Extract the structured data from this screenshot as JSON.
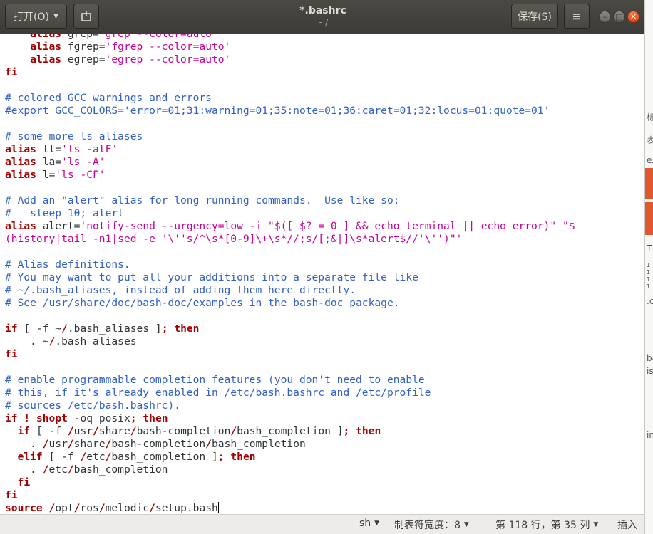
{
  "header": {
    "open_label": "打开(O)",
    "save_label": "保存(S)",
    "title": "*.bashrc",
    "subtitle": "~/"
  },
  "icons": {
    "open_dropdown": "chevron-down-icon",
    "new_document": "new-document-icon",
    "menu": "hamburger-menu-icon",
    "minimize": "window-minimize-icon",
    "maximize": "window-maximize-icon",
    "close": "window-close-icon"
  },
  "editor": {
    "lines": [
      [
        {
          "t": "    "
        },
        {
          "t": "alias",
          "c": "kw"
        },
        {
          "t": " grep="
        },
        {
          "t": "'grep --color=auto'",
          "c": "str"
        }
      ],
      [
        {
          "t": "    "
        },
        {
          "t": "alias",
          "c": "kw"
        },
        {
          "t": " fgrep="
        },
        {
          "t": "'fgrep --color=auto'",
          "c": "str"
        }
      ],
      [
        {
          "t": "    "
        },
        {
          "t": "alias",
          "c": "kw"
        },
        {
          "t": " egrep="
        },
        {
          "t": "'egrep --color=auto'",
          "c": "str"
        }
      ],
      [
        {
          "t": "fi",
          "c": "kw"
        }
      ],
      [],
      [
        {
          "t": "# colored GCC warnings and errors",
          "c": "cm"
        }
      ],
      [
        {
          "t": "#export GCC_COLORS='error=01;31:warning=01;35:note=01;36:caret=01;32:locus=01:quote=01'",
          "c": "cm"
        }
      ],
      [],
      [
        {
          "t": "# some more ls aliases",
          "c": "cm"
        }
      ],
      [
        {
          "t": "alias",
          "c": "kw"
        },
        {
          "t": " ll="
        },
        {
          "t": "'ls -alF'",
          "c": "str"
        }
      ],
      [
        {
          "t": "alias",
          "c": "kw"
        },
        {
          "t": " la="
        },
        {
          "t": "'ls -A'",
          "c": "str"
        }
      ],
      [
        {
          "t": "alias",
          "c": "kw"
        },
        {
          "t": " l="
        },
        {
          "t": "'ls -CF'",
          "c": "str"
        }
      ],
      [],
      [
        {
          "t": "# Add an \"alert\" alias for long running commands.  Use like so:",
          "c": "cm"
        }
      ],
      [
        {
          "t": "#   sleep 10; alert",
          "c": "cm"
        }
      ],
      [
        {
          "t": "alias",
          "c": "kw"
        },
        {
          "t": " alert="
        },
        {
          "t": "'notify-send --urgency=low -i \"$([ $? = 0 ] && echo terminal || echo error)\" \"$",
          "c": "str"
        }
      ],
      [
        {
          "t": "(history|tail -n1|sed -e '\\''s/^\\s*[0-9]\\+\\s*//;s/[;&|]\\s*alert$//'\\'')\"'",
          "c": "str"
        }
      ],
      [],
      [
        {
          "t": "# Alias definitions.",
          "c": "cm"
        }
      ],
      [
        {
          "t": "# You may want to put all your additions into a separate file like",
          "c": "cm"
        }
      ],
      [
        {
          "t": "# ~/.bash_aliases, instead of adding them here directly.",
          "c": "cm"
        }
      ],
      [
        {
          "t": "# See /usr/share/doc/bash-doc/examples in the bash-doc package.",
          "c": "cm"
        }
      ],
      [],
      [
        {
          "t": "if",
          "c": "kw"
        },
        {
          "t": " [ -f ~"
        },
        {
          "t": "/",
          "c": "kw"
        },
        {
          "t": ".bash_aliases ]"
        },
        {
          "t": ";",
          "c": "kw"
        },
        {
          "t": " "
        },
        {
          "t": "then",
          "c": "kw"
        }
      ],
      [
        {
          "t": "    . ~"
        },
        {
          "t": "/",
          "c": "kw"
        },
        {
          "t": ".bash_aliases"
        }
      ],
      [
        {
          "t": "fi",
          "c": "kw"
        }
      ],
      [],
      [
        {
          "t": "# enable programmable completion features (you don't need to enable",
          "c": "cm"
        }
      ],
      [
        {
          "t": "# this, if it's already enabled in /etc/bash.bashrc and /etc/profile",
          "c": "cm"
        }
      ],
      [
        {
          "t": "# sources /etc/bash.bashrc).",
          "c": "cm"
        }
      ],
      [
        {
          "t": "if",
          "c": "kw"
        },
        {
          "t": " "
        },
        {
          "t": "!",
          "c": "kw"
        },
        {
          "t": " "
        },
        {
          "t": "shopt",
          "c": "kw"
        },
        {
          "t": " -oq posix"
        },
        {
          "t": ";",
          "c": "kw"
        },
        {
          "t": " "
        },
        {
          "t": "then",
          "c": "kw"
        }
      ],
      [
        {
          "t": "  "
        },
        {
          "t": "if",
          "c": "kw"
        },
        {
          "t": " [ -f "
        },
        {
          "t": "/",
          "c": "kw"
        },
        {
          "t": "usr"
        },
        {
          "t": "/",
          "c": "kw"
        },
        {
          "t": "share"
        },
        {
          "t": "/",
          "c": "kw"
        },
        {
          "t": "bash-completion"
        },
        {
          "t": "/",
          "c": "kw"
        },
        {
          "t": "bash_completion ]"
        },
        {
          "t": ";",
          "c": "kw"
        },
        {
          "t": " "
        },
        {
          "t": "then",
          "c": "kw"
        }
      ],
      [
        {
          "t": "    . "
        },
        {
          "t": "/",
          "c": "kw"
        },
        {
          "t": "usr"
        },
        {
          "t": "/",
          "c": "kw"
        },
        {
          "t": "share"
        },
        {
          "t": "/",
          "c": "kw"
        },
        {
          "t": "bash-completion"
        },
        {
          "t": "/",
          "c": "kw"
        },
        {
          "t": "bash_completion"
        }
      ],
      [
        {
          "t": "  "
        },
        {
          "t": "elif",
          "c": "kw"
        },
        {
          "t": " [ -f "
        },
        {
          "t": "/",
          "c": "kw"
        },
        {
          "t": "etc"
        },
        {
          "t": "/",
          "c": "kw"
        },
        {
          "t": "bash_completion ]"
        },
        {
          "t": ";",
          "c": "kw"
        },
        {
          "t": " "
        },
        {
          "t": "then",
          "c": "kw"
        }
      ],
      [
        {
          "t": "    . "
        },
        {
          "t": "/",
          "c": "kw"
        },
        {
          "t": "etc"
        },
        {
          "t": "/",
          "c": "kw"
        },
        {
          "t": "bash_completion"
        }
      ],
      [
        {
          "t": "  "
        },
        {
          "t": "fi",
          "c": "kw"
        }
      ],
      [
        {
          "t": "fi",
          "c": "kw"
        }
      ],
      [
        {
          "t": "source",
          "c": "kw"
        },
        {
          "t": " "
        },
        {
          "t": "/",
          "c": "kw"
        },
        {
          "t": "opt"
        },
        {
          "t": "/",
          "c": "kw"
        },
        {
          "t": "ros"
        },
        {
          "t": "/",
          "c": "kw"
        },
        {
          "t": "melodic"
        },
        {
          "t": "/",
          "c": "kw"
        },
        {
          "t": "setup.bash"
        }
      ]
    ]
  },
  "statusbar": {
    "language": "sh",
    "tab_width": "制表符宽度：8",
    "position": "第 118 行，第 35 列",
    "mode": "插入"
  },
  "background_window": {
    "fragments": [
      "标",
      "表",
      "eX",
      "T",
      "1",
      "1",
      "1",
      "1",
      ".c",
      "ba",
      "is",
      "in"
    ]
  }
}
